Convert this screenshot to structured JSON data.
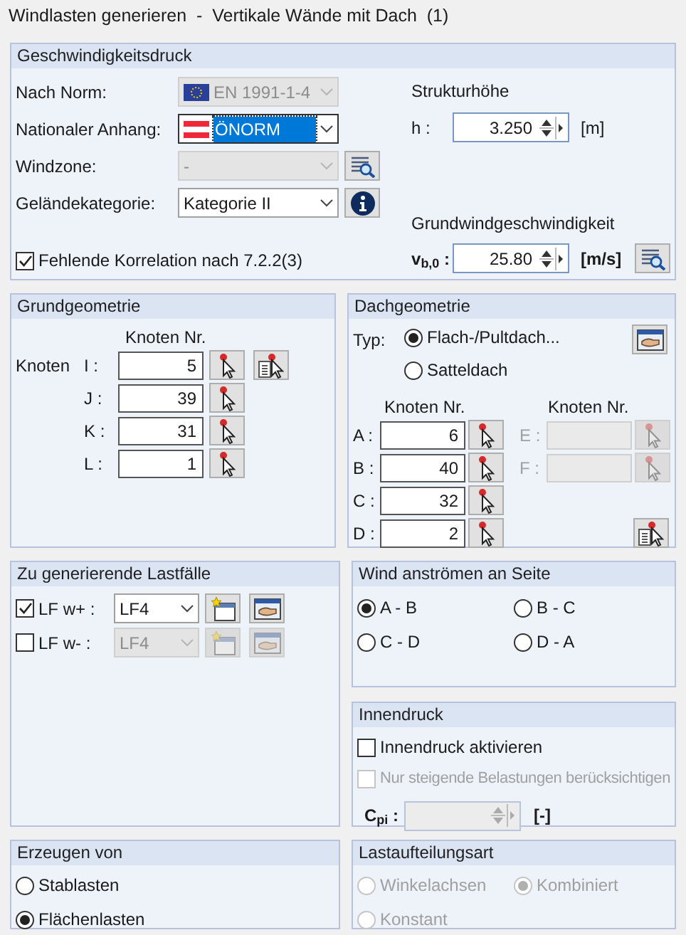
{
  "window": {
    "title": "Windlasten generieren  -  Vertikale Wände mit Dach  (1)"
  },
  "velocity_pressure": {
    "title": "Geschwindigkeitsdruck",
    "rows": [
      {
        "kind": "norm",
        "label": "Nach Norm:",
        "value": "EN 1991-1-4",
        "disabled": true,
        "focused": false
      },
      {
        "kind": "annex",
        "label": "Nationaler Anhang:",
        "value": "ÖNORM",
        "disabled": false,
        "focused": true
      },
      {
        "kind": "zone",
        "label": "Windzone:",
        "value": "-",
        "disabled": true,
        "focused": false
      },
      {
        "kind": "terrain",
        "label": "Geländekategorie:",
        "value": "Kategorie II",
        "disabled": false,
        "focused": false
      }
    ],
    "missing_correlation": {
      "label": "Fehlende Korrelation nach 7.2.2(3)",
      "checked": true
    },
    "structure_height": {
      "title": "Strukturhöhe",
      "label": "h :",
      "value": "3.250",
      "unit": "[m]"
    },
    "basic_wind_speed": {
      "title": "Grundwindgeschwindigkeit",
      "label": "v$_{b,0}$ :",
      "value": "25.80",
      "unit": "[m/s]"
    }
  },
  "base_geometry": {
    "title": "Grundgeometrie",
    "column_header": "Knoten Nr.",
    "row_label": "Knoten",
    "nodes": [
      {
        "label": "I :",
        "value": "5"
      },
      {
        "label": "J :",
        "value": "39"
      },
      {
        "label": "K :",
        "value": "31"
      },
      {
        "label": "L :",
        "value": "1"
      }
    ]
  },
  "roof_geometry": {
    "title": "Dachgeometrie",
    "type_label": "Typ:",
    "types": [
      {
        "label": "Flach-/Pultdach...",
        "selected": true
      },
      {
        "label": "Satteldach",
        "selected": false
      }
    ],
    "left": {
      "column_header": "Knoten Nr.",
      "nodes": [
        {
          "label": "A :",
          "value": "6",
          "disabled": false
        },
        {
          "label": "B :",
          "value": "40",
          "disabled": false
        },
        {
          "label": "C :",
          "value": "32",
          "disabled": false
        },
        {
          "label": "D :",
          "value": "2",
          "disabled": false
        }
      ]
    },
    "right": {
      "column_header": "Knoten Nr.",
      "nodes": [
        {
          "label": "E :",
          "disabled": true
        },
        {
          "label": "F :",
          "disabled": true
        }
      ]
    }
  },
  "load_cases": {
    "title": "Zu generierende Lastfälle",
    "rows": [
      {
        "label": "LF w+ :",
        "checked": true,
        "value": "LF4",
        "disabled": false
      },
      {
        "label": "LF w- :",
        "checked": false,
        "value": "LF4",
        "disabled": true
      }
    ]
  },
  "wind_side": {
    "title": "Wind anströmen an Seite",
    "options": [
      {
        "label": "A - B",
        "selected": true
      },
      {
        "label": "B - C",
        "selected": false
      },
      {
        "label": "C - D",
        "selected": false
      },
      {
        "label": "D - A",
        "selected": false
      }
    ]
  },
  "internal_pressure": {
    "title": "Innendruck",
    "options": [
      {
        "label": "Innendruck aktivieren",
        "checked": false,
        "disabled": false
      },
      {
        "label": "Nur steigende Belastungen berücksichtigen",
        "checked": false,
        "disabled": true
      }
    ],
    "cpi": {
      "label": "C$_{pi}$ :",
      "unit": "[-]",
      "disabled": true
    }
  },
  "generate_from": {
    "title": "Erzeugen von",
    "options": [
      {
        "label": "Stablasten",
        "selected": false
      },
      {
        "label": "Flächenlasten",
        "selected": true
      }
    ]
  },
  "load_distribution": {
    "title": "Lastaufteilungsart",
    "options": [
      {
        "label": "Winkelachsen",
        "selected": false,
        "disabled": true
      },
      {
        "label": "Kombiniert",
        "selected": true,
        "disabled": true
      },
      {
        "label": "Konstant",
        "selected": false,
        "disabled": true
      }
    ]
  }
}
